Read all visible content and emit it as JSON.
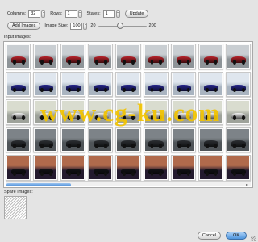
{
  "toolbar": {
    "columns_label": "Columns:",
    "columns_value": "32",
    "rows_label": "Rows:",
    "rows_value": "1",
    "states_label": "States:",
    "states_value": "1",
    "update_label": "Update"
  },
  "image_row": {
    "add_images_label": "Add Images",
    "image_size_label": "Image Size:",
    "image_size_value": "100",
    "slider_min": "20",
    "slider_max": "200",
    "slider_position": 0.45
  },
  "input_images": {
    "label": "Input Images:",
    "rows": [
      {
        "background": "#8e9498",
        "sky": "#c9ced2",
        "car_color": "#b8232b"
      },
      {
        "background": "#a9b4c0",
        "sky": "#dfe6ee",
        "car_color": "#27278f"
      },
      {
        "background": "#9ea29a",
        "sky": "#d9dccf",
        "car_color": "#f4f4f4"
      },
      {
        "background": "#4f5458",
        "sky": "#7d8388",
        "car_color": "#2c2f33"
      },
      {
        "background": "#231a2e",
        "sky": "#b06a4c",
        "car_color": "#141418"
      }
    ],
    "columns": 9
  },
  "spare_images": {
    "label": "Spare Images:"
  },
  "footer": {
    "cancel_label": "Cancel",
    "ok_label": "OK"
  },
  "watermark": {
    "text": "www.cg-ku.com"
  },
  "colors": {
    "window_bg": "#e4e4e4",
    "accent": "#4e95dd",
    "watermark": "#f3c400"
  }
}
